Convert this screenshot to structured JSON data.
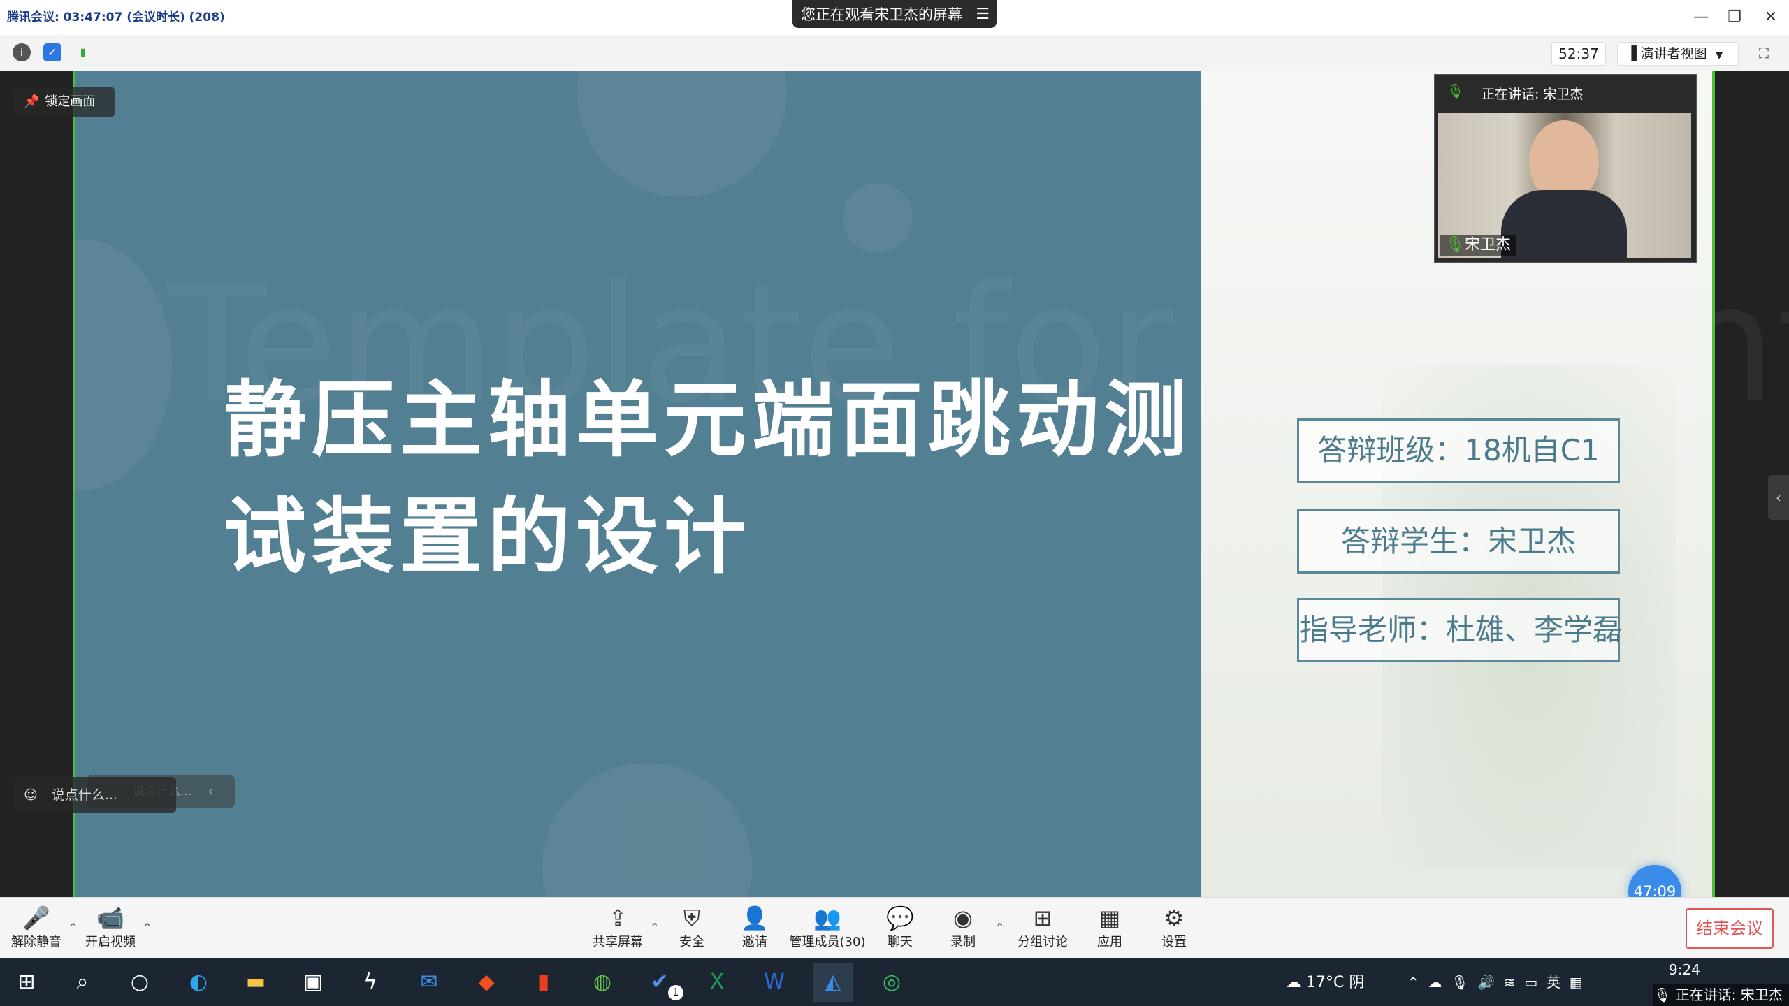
{
  "titlebar": {
    "meeting_info": "腾讯会议: 03:47:07 (会议时长) (208)",
    "share_banner": "您正在观看宋卫杰的屏幕",
    "banner_menu_icon": "list-icon"
  },
  "toolbar": {
    "timer": "52:37",
    "view_mode": "演讲者视图"
  },
  "slide": {
    "title_line1": "静压主轴单元端面跳动测",
    "title_line2": "试装置的设计",
    "watermark": "Template for student",
    "info": [
      "答辩班级：18机自C1",
      "答辩学生：宋卫杰",
      "指导老师：杜雄、李学磊"
    ]
  },
  "overlays": {
    "lock_label": "锁定画面",
    "speaking_label": "正在讲话: 宋卫杰",
    "video_name": "宋卫杰",
    "chat_placeholder": "说点什么...",
    "chat_placeholder_ghost": "说点什么...",
    "countdown": "47:09"
  },
  "meetbar": {
    "unmute": "解除静音",
    "video": "开启视频",
    "share": "共享屏幕",
    "security": "安全",
    "invite": "邀请",
    "members": "管理成员(30)",
    "chat": "聊天",
    "record": "录制",
    "breakout": "分组讨论",
    "apps": "应用",
    "settings": "设置",
    "end": "结束会议"
  },
  "taskbar": {
    "weather": "17°C 阴",
    "ime": "英",
    "time": "9:24",
    "speaking": "正在讲话: 宋卫杰",
    "badge": "1"
  },
  "colors": {
    "slide_bg": "#527f91",
    "accent_green": "#49c234",
    "end_red": "#e15656",
    "countdown_blue": "#3b8be8"
  }
}
